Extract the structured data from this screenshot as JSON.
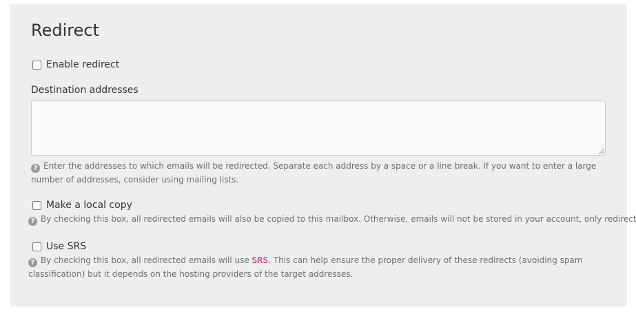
{
  "redirect": {
    "title": "Redirect",
    "enable_label": "Enable redirect",
    "destination_label": "Destination addresses",
    "destination_value": "",
    "destination_help": "Enter the addresses to which emails will be redirected. Separate each address by a space or a line break. If you want to enter a large number of addresses, consider using mailing lists.",
    "local_copy_label": "Make a local copy",
    "local_copy_help": "By checking this box, all redirected emails will also be copied to this mailbox. Otherwise, emails will not be stored in your account, only redirected.",
    "srs_label": "Use SRS",
    "srs_help_before": "By checking this box, all redirected emails will use ",
    "srs_link": "SRS",
    "srs_help_after": ". This can help ensure the proper delivery of these redirects (avoiding spam classification) but it depends on the hosting providers of the target addresses.",
    "help_icon_glyph": "?",
    "enable_checked": false,
    "local_copy_checked": false,
    "srs_checked": false
  },
  "colors": {
    "panel_bg": "#eeeeee",
    "link": "#c2185b",
    "help_text": "#6f6f6f"
  },
  "icons": {
    "help": "question-circle-icon"
  }
}
